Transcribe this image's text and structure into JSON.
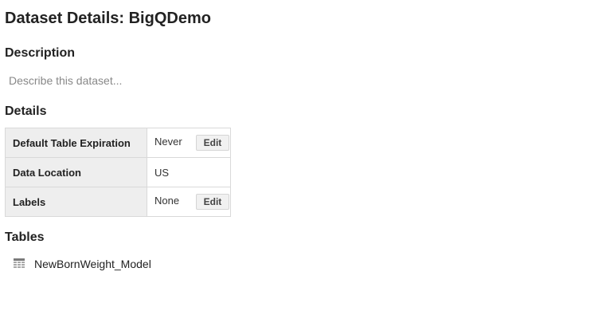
{
  "page": {
    "title": "Dataset Details: BigQDemo"
  },
  "description": {
    "heading": "Description",
    "placeholder": "Describe this dataset..."
  },
  "details": {
    "heading": "Details",
    "rows": [
      {
        "label": "Default Table Expiration",
        "value": "Never",
        "action": "Edit"
      },
      {
        "label": "Data Location",
        "value": "US"
      },
      {
        "label": "Labels",
        "value": "None",
        "action": "Edit"
      }
    ]
  },
  "tables": {
    "heading": "Tables",
    "items": [
      {
        "name": "NewBornWeight_Model",
        "icon": "table-grid-icon"
      }
    ]
  }
}
